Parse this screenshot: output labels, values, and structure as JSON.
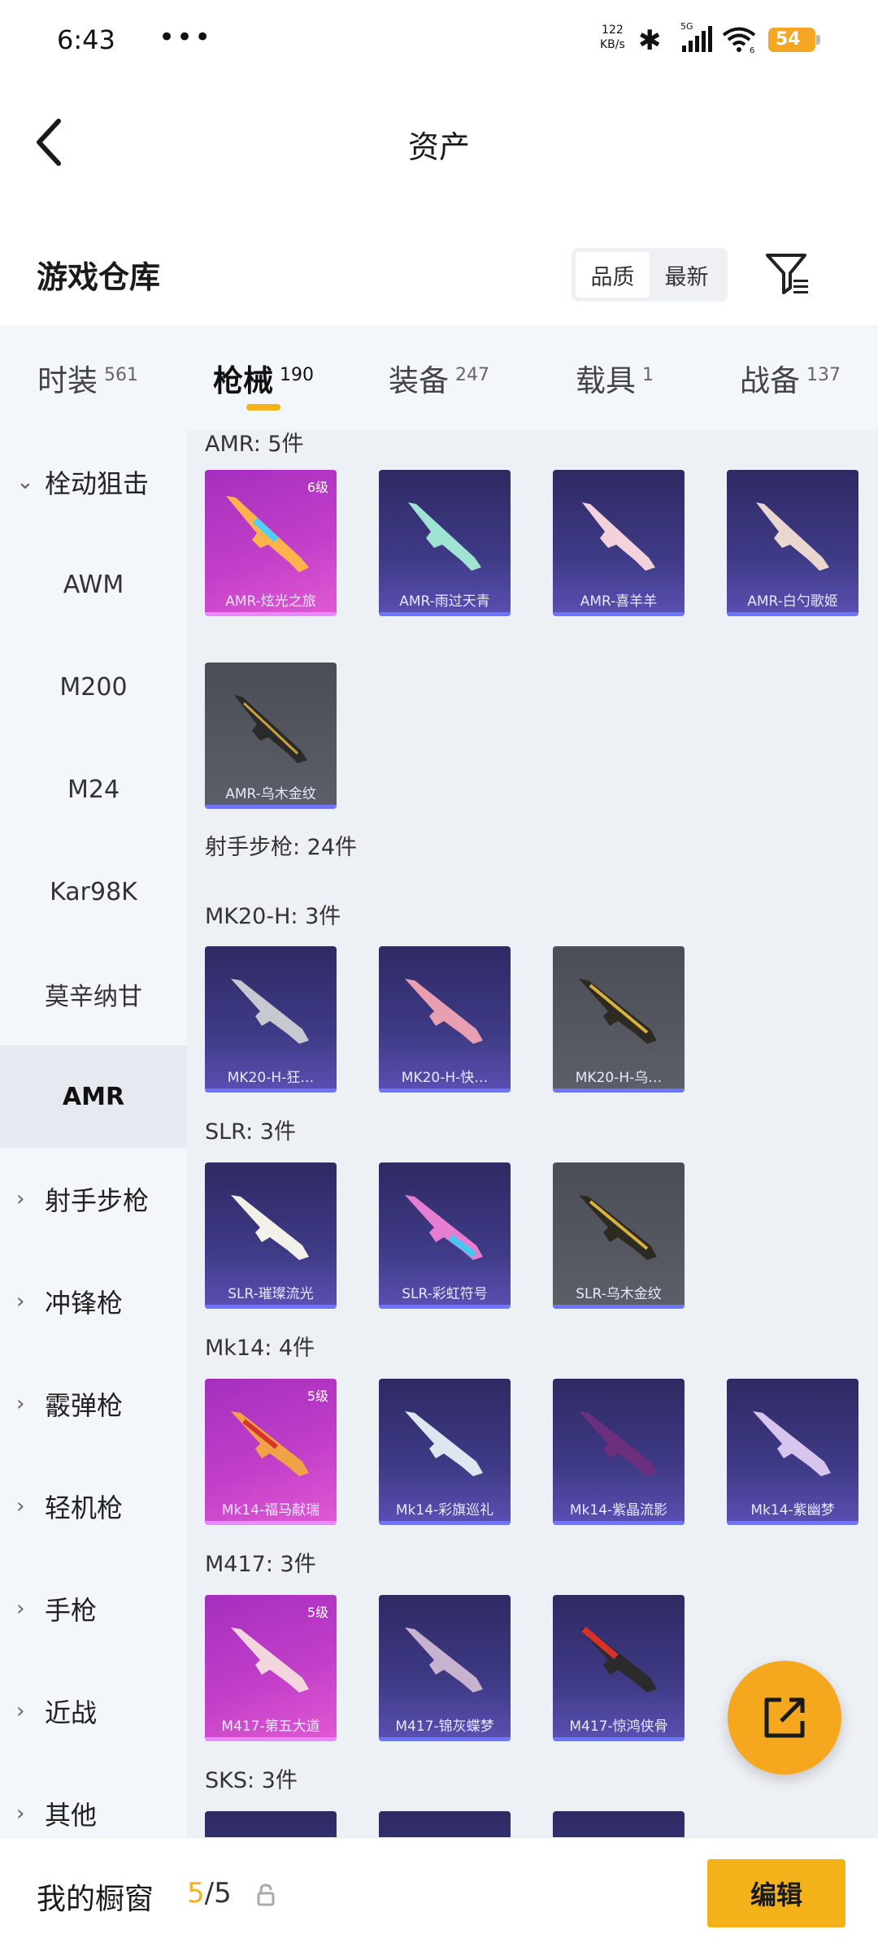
{
  "status_bar": {
    "time": "6:43",
    "dots": "•••",
    "speed_value": "122",
    "speed_unit": "KB/s",
    "network": "5G",
    "wifi_sub": "6",
    "battery": "54"
  },
  "header": {
    "title": "资产",
    "back_icon": "chevron-left-icon"
  },
  "warehouse": {
    "title": "游戏仓库",
    "sort_options": [
      "品质",
      "最新"
    ],
    "active_sort": "品质",
    "filter_icon": "filter-icon"
  },
  "tabs": [
    {
      "label": "时装",
      "count": "561"
    },
    {
      "label": "枪械",
      "count": "190"
    },
    {
      "label": "装备",
      "count": "247"
    },
    {
      "label": "载具",
      "count": "1"
    },
    {
      "label": "战备",
      "count": "137"
    }
  ],
  "active_tab": "枪械",
  "sidebar": {
    "items": [
      {
        "label": "栓动狙击",
        "type": "group-open"
      },
      {
        "label": "AWM",
        "type": "sub"
      },
      {
        "label": "M200",
        "type": "sub"
      },
      {
        "label": "M24",
        "type": "sub"
      },
      {
        "label": "Kar98K",
        "type": "sub"
      },
      {
        "label": "莫辛纳甘",
        "type": "sub"
      },
      {
        "label": "AMR",
        "type": "sub-active"
      },
      {
        "label": "射手步枪",
        "type": "group"
      },
      {
        "label": "冲锋枪",
        "type": "group"
      },
      {
        "label": "霰弹枪",
        "type": "group"
      },
      {
        "label": "轻机枪",
        "type": "group"
      },
      {
        "label": "手枪",
        "type": "group"
      },
      {
        "label": "近战",
        "type": "group"
      },
      {
        "label": "其他",
        "type": "group"
      }
    ]
  },
  "sections": {
    "amr": "AMR: 5件",
    "marksman": "射手步枪: 24件",
    "mk20": "MK20-H: 3件",
    "slr": "SLR: 3件",
    "mk14": "Mk14: 4件",
    "m417": "M417: 3件",
    "sks": "SKS: 3件"
  },
  "cards": {
    "amr": [
      {
        "name": "AMR-炫光之旅",
        "level": "6级"
      },
      {
        "name": "AMR-雨过天青"
      },
      {
        "name": "AMR-喜羊羊"
      },
      {
        "name": "AMR-白勺歌姬"
      },
      {
        "name": "AMR-乌木金纹"
      }
    ],
    "mk20": [
      {
        "name": "MK20-H-狂…"
      },
      {
        "name": "MK20-H-快…"
      },
      {
        "name": "MK20-H-乌…"
      }
    ],
    "slr": [
      {
        "name": "SLR-璀璨流光"
      },
      {
        "name": "SLR-彩虹符号"
      },
      {
        "name": "SLR-乌木金纹"
      }
    ],
    "mk14": [
      {
        "name": "Mk14-福马献瑞",
        "level": "5级"
      },
      {
        "name": "Mk14-彩旗巡礼"
      },
      {
        "name": "Mk14-紫晶流影"
      },
      {
        "name": "Mk14-紫幽梦"
      }
    ],
    "m417": [
      {
        "name": "M417-第五大道",
        "level": "5级"
      },
      {
        "name": "M417-锦灰蝶梦"
      },
      {
        "name": "M417-惊鸿侠骨"
      }
    ]
  },
  "bottom_bar": {
    "title": "我的橱窗",
    "count_current": "5",
    "count_total": "/5",
    "edit": "编辑"
  },
  "fab_icon": "share-external-icon",
  "colors": {
    "accent": "#f4b21a",
    "card_purple": "#3f3a86",
    "card_pink": "#c13ec8",
    "card_gray": "#555760"
  }
}
